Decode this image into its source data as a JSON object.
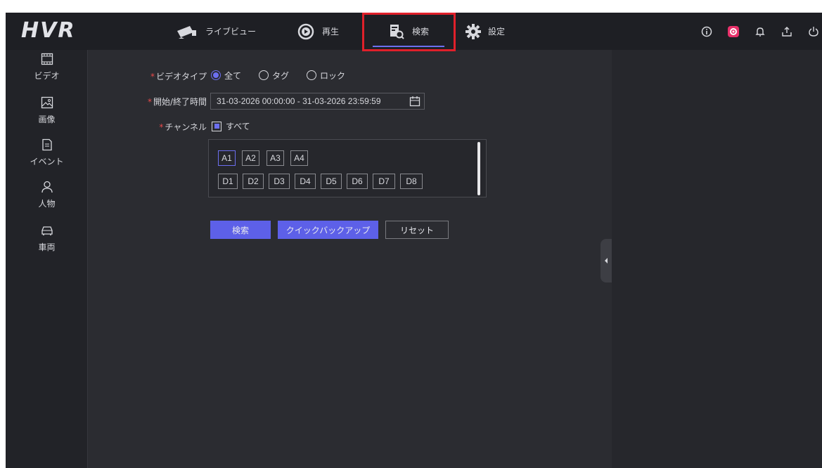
{
  "app": {
    "logo": "HVR"
  },
  "nav": {
    "live_view": "ライブビュー",
    "playback": "再生",
    "search": "検索",
    "settings": "設定"
  },
  "topbar_icons": [
    "info-icon",
    "record-icon",
    "bell-icon",
    "download-icon",
    "power-icon"
  ],
  "sidebar": {
    "items": [
      {
        "label": "ビデオ",
        "icon": "film-icon"
      },
      {
        "label": "画像",
        "icon": "image-icon"
      },
      {
        "label": "イベント",
        "icon": "document-icon"
      },
      {
        "label": "人物",
        "icon": "person-icon"
      },
      {
        "label": "車両",
        "icon": "car-icon"
      }
    ]
  },
  "form": {
    "video_type_label": "ビデオタイプ",
    "video_type_options": [
      "全て",
      "タグ",
      "ロック"
    ],
    "video_type_selected": "全て",
    "time_label": "開始/終了時間",
    "time_value": "31-03-2026 00:00:00 - 31-03-2026 23:59:59",
    "channel_label": "チャンネル",
    "channel_all_label": "すべて",
    "channels_row1": [
      "A1",
      "A2",
      "A3",
      "A4"
    ],
    "channels_row2": [
      "D1",
      "D2",
      "D3",
      "D4",
      "D5",
      "D6",
      "D7",
      "D8"
    ]
  },
  "buttons": {
    "search": "検索",
    "quick_backup": "クイックバックアップ",
    "reset": "リセット"
  },
  "colors": {
    "accent": "#5d60e8",
    "highlight": "#e0202a",
    "required": "#e84a4a"
  }
}
